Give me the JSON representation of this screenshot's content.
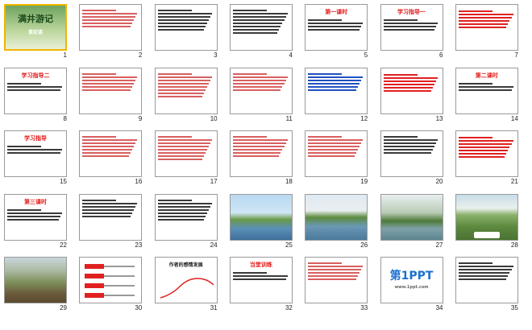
{
  "slides": [
    {
      "n": "1",
      "type": "cover",
      "title": "满井游记",
      "subtitle": "袁宏道"
    },
    {
      "n": "2",
      "type": "text",
      "color": "red",
      "lines": 6
    },
    {
      "n": "3",
      "type": "text",
      "color": "dark",
      "lines": 7
    },
    {
      "n": "4",
      "type": "text",
      "color": "dark",
      "lines": 8
    },
    {
      "n": "5",
      "type": "objectives",
      "title": "第一课时",
      "lines": 4
    },
    {
      "n": "6",
      "type": "objectives",
      "title": "学习指导一",
      "lines": 4
    },
    {
      "n": "7",
      "type": "list",
      "lines": 6
    },
    {
      "n": "8",
      "type": "objectives",
      "title": "学习指导二",
      "lines": 3
    },
    {
      "n": "9",
      "type": "text",
      "color": "red",
      "lines": 6
    },
    {
      "n": "10",
      "type": "text",
      "color": "red",
      "lines": 8
    },
    {
      "n": "11",
      "type": "text",
      "color": "red",
      "lines": 6
    },
    {
      "n": "12",
      "type": "text",
      "color": "blue",
      "lines": 6
    },
    {
      "n": "13",
      "type": "list",
      "lines": 6
    },
    {
      "n": "14",
      "type": "objectives",
      "title": "第二课时",
      "lines": 3
    },
    {
      "n": "15",
      "type": "objectives",
      "title": "学习指导",
      "lines": 3
    },
    {
      "n": "16",
      "type": "text",
      "color": "red",
      "lines": 7
    },
    {
      "n": "17",
      "type": "text",
      "color": "red",
      "lines": 8
    },
    {
      "n": "18",
      "type": "text",
      "color": "red",
      "lines": 7
    },
    {
      "n": "19",
      "type": "text",
      "color": "red",
      "lines": 7
    },
    {
      "n": "20",
      "type": "text",
      "color": "dark",
      "lines": 6
    },
    {
      "n": "21",
      "type": "list",
      "lines": 7
    },
    {
      "n": "22",
      "type": "objectives",
      "title": "第三课时",
      "lines": 4
    },
    {
      "n": "23",
      "type": "text",
      "color": "dark",
      "lines": 6
    },
    {
      "n": "24",
      "type": "text",
      "color": "dark",
      "lines": 7
    },
    {
      "n": "25",
      "type": "photo",
      "scene": "lake-willow"
    },
    {
      "n": "26",
      "type": "photo",
      "scene": "park-river"
    },
    {
      "n": "27",
      "type": "photo",
      "scene": "pagoda-lake"
    },
    {
      "n": "28",
      "type": "photo",
      "scene": "green-field"
    },
    {
      "n": "29",
      "type": "photo",
      "scene": "mountain-slope"
    },
    {
      "n": "30",
      "type": "diagram"
    },
    {
      "n": "31",
      "type": "diagram2",
      "title": "作者的感情发展"
    },
    {
      "n": "32",
      "type": "objectives",
      "title": "当堂训练",
      "lines": 3
    },
    {
      "n": "33",
      "type": "text",
      "color": "red",
      "lines": 6
    },
    {
      "n": "34",
      "type": "logo",
      "brand": "第1PPT"
    },
    {
      "n": "35",
      "type": "text",
      "color": "dark",
      "lines": 6
    }
  ],
  "logo_sub": "www.1ppt.com",
  "colors": {
    "accent": "#e02020",
    "selection": "#f0b400",
    "title_red": "#e31c1c",
    "blue": "#2050c0"
  }
}
